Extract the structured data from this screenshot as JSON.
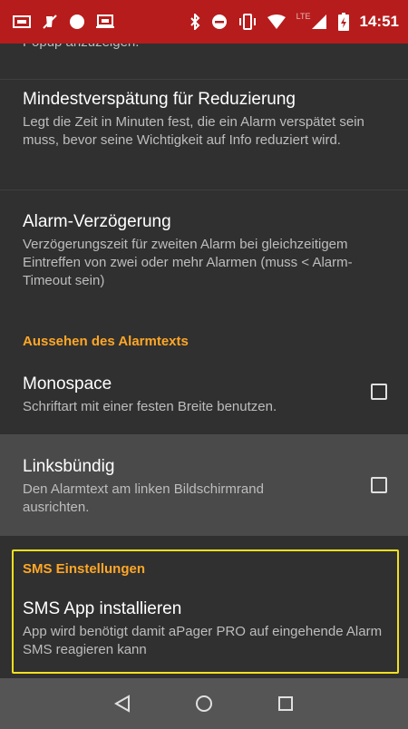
{
  "status_bar": {
    "time": "14:51",
    "network": "LTE",
    "icons": [
      "cast-icon",
      "mute-icon",
      "record-icon",
      "screen-icon",
      "bluetooth-icon",
      "do-not-disturb-icon",
      "vibrate-icon",
      "wifi-icon",
      "signal-icon",
      "battery-icon"
    ],
    "color": "#b71c1c"
  },
  "settings": {
    "cut_off_summary": "Popup anzuzeigen.",
    "min_delay": {
      "title": "Mindestverspätung für Reduzierung",
      "summary": "Legt die Zeit in Minuten fest, die ein Alarm verspätet sein muss, bevor seine Wichtigkeit auf Info reduziert wird."
    },
    "alarm_delay": {
      "title": "Alarm-Verzögerung",
      "summary": "Verzögerungszeit für zweiten Alarm bei gleichzeiti­gem Eintreffen von zwei oder mehr Alarmen (muss < Alarm-Timeout sein)"
    },
    "section_appearance": "Aussehen des Alarmtexts",
    "monospace": {
      "title": "Monospace",
      "summary": "Schriftart mit einer festen Breite benutzen.",
      "checked": false
    },
    "left_align": {
      "title": "Linksbündig",
      "summary": "Den Alarmtext am linken Bildschirmrand ausrichten.",
      "checked": false
    },
    "section_sms": "SMS Einstellungen",
    "sms_app": {
      "title": "SMS App installieren",
      "summary": "App wird benötigt damit aPager PRO auf eingehende Alarm SMS reagieren kann"
    }
  },
  "colors": {
    "accent": "#ffa726",
    "highlight_box": "#f2e01e",
    "background": "#303030"
  },
  "nav_bar": {
    "buttons": [
      "back-icon",
      "home-icon",
      "recents-icon"
    ]
  }
}
